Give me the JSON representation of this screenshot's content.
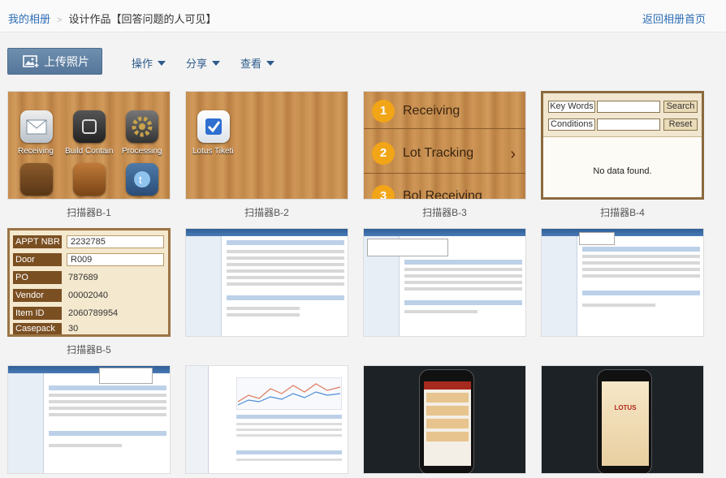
{
  "breadcrumb": {
    "home": "我的相册",
    "separator": ">",
    "current": "设计作品【回答问题的人可见】"
  },
  "back_link": "返回相册首页",
  "toolbar": {
    "upload_label": "上传照片",
    "menu_actions": "操作",
    "menu_share": "分享",
    "menu_view": "查看"
  },
  "colors": {
    "link": "#2d6db5",
    "upload_button": "#6385a9"
  },
  "photos": [
    {
      "caption": "扫描器B-1",
      "icons": [
        {
          "label": "Receiving",
          "icon": "envelope-icon"
        },
        {
          "label": "Build Contain",
          "icon": "container-icon"
        },
        {
          "label": "Processing",
          "icon": "gear-icon"
        }
      ]
    },
    {
      "caption": "扫描器B-2",
      "icons": [
        {
          "label": "Lotus Tiketi",
          "icon": "checkmark-icon"
        }
      ]
    },
    {
      "caption": "扫描器B-3",
      "items": [
        "Receiving",
        "Lot Tracking",
        "Bol Receiving"
      ],
      "numbers": [
        "1",
        "2",
        "3"
      ]
    },
    {
      "caption": "扫描器B-4",
      "fields": [
        "Key Words",
        "Conditions"
      ],
      "buttons": [
        "Search",
        "Reset"
      ],
      "message": "No data found."
    },
    {
      "caption": "扫描器B-5",
      "rows": [
        {
          "label": "APPT NBR",
          "value": "2232785"
        },
        {
          "label": "Door",
          "value": "R009"
        },
        {
          "label": "PO",
          "value": "787689"
        },
        {
          "label": "Vendor",
          "value": "00002040"
        },
        {
          "label": "Item ID",
          "value": "2060789954"
        },
        {
          "label": "Casepack",
          "value": "30"
        }
      ]
    },
    {
      "caption": ""
    },
    {
      "caption": ""
    },
    {
      "caption": ""
    },
    {
      "caption": ""
    },
    {
      "caption": ""
    },
    {
      "caption": ""
    },
    {
      "caption": ""
    }
  ],
  "phone_logo": "LOTUS"
}
